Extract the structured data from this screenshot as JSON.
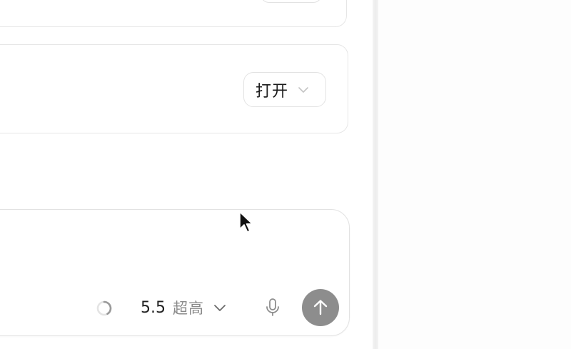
{
  "setting_card": {
    "select_value": "打开"
  },
  "composer": {
    "model_version": "5.5",
    "model_level": "超高"
  },
  "icons": {
    "select_chevron": "chevron-down-icon",
    "model_chevron": "chevron-down-icon",
    "spinner": "loading-spinner-icon",
    "mic": "microphone-icon",
    "send": "arrow-up-icon",
    "cursor": "mouse-pointer-icon"
  },
  "colors": {
    "send_button": "#8d8d8d",
    "border": "#e2e2e2",
    "muted_text": "#8a8a8a"
  }
}
